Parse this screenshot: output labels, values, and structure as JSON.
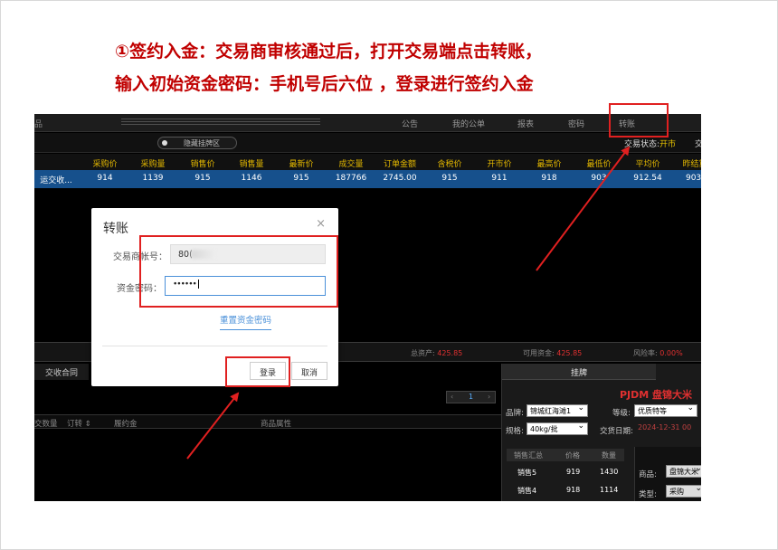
{
  "instruction": {
    "line1": "①签约入金：交易商审核通过后，打开交易端点击转账，",
    "line2": "输入初始资金密码：手机号后六位 ，登录进行签约入金"
  },
  "topnav": {
    "product": "品",
    "items": [
      "公告",
      "我的公单",
      "报表",
      "密码",
      "转账"
    ]
  },
  "subbar": {
    "toggle_label": "隐藏挂牌区",
    "status_label": "交易状态:",
    "status_value": "开市",
    "right_cut": "交"
  },
  "quote": {
    "headers": [
      "采购价",
      "采购量",
      "销售价",
      "销售量",
      "最新价",
      "成交量",
      "订单金额",
      "含税价",
      "开市价",
      "最高价",
      "最低价",
      "平均价",
      "昨结算"
    ],
    "row": [
      "运交收...",
      "914",
      "1139",
      "915",
      "1146",
      "915",
      "187766",
      "2745.00",
      "915",
      "911",
      "918",
      "903",
      "912.54",
      "903."
    ]
  },
  "assets": {
    "total_label": "总资产:",
    "total_value": "425.85",
    "avail_label": "可用资金:",
    "avail_value": "425.85",
    "risk_label": "风险率:",
    "risk_value": "0.00%"
  },
  "lower": {
    "tab": "交收合同",
    "pager": {
      "prev": "‹",
      "page": "1",
      "next": "›"
    },
    "headers": [
      "交数量",
      "订转 ⇕",
      "履约金",
      "商品属性"
    ]
  },
  "rpanel": {
    "tab": "挂牌",
    "title": "PJDM 盘锦大米",
    "brand_label": "品牌:",
    "brand_value": "锦城红海滩1",
    "grade_label": "等级:",
    "grade_value": "优质特等",
    "spec_label": "规格:",
    "spec_value": "40kg/批",
    "date_label": "交货日期:",
    "date_value": "2024-12-31 00",
    "book_headers": [
      "销售汇总",
      "价格",
      "数量"
    ],
    "book_rows": [
      [
        "销售5",
        "919",
        "1430"
      ],
      [
        "销售4",
        "918",
        "1114"
      ]
    ],
    "product_label": "商品:",
    "product_value": "盘锦大米",
    "type_label": "类型:",
    "type_value": "采购"
  },
  "modal": {
    "title": "转账",
    "close": "×",
    "acct_label": "交易商帐号：",
    "acct_value": "80(",
    "pwd_label": "资金密码：",
    "pwd_value": "••••••",
    "reset_link": "重置资金密码",
    "login_button": "登录",
    "cancel_button": "取消"
  },
  "colors": {
    "highlight": "#e02020",
    "instruction": "#c00000",
    "selected_row": "#16508c",
    "header_text": "#e4b800"
  }
}
